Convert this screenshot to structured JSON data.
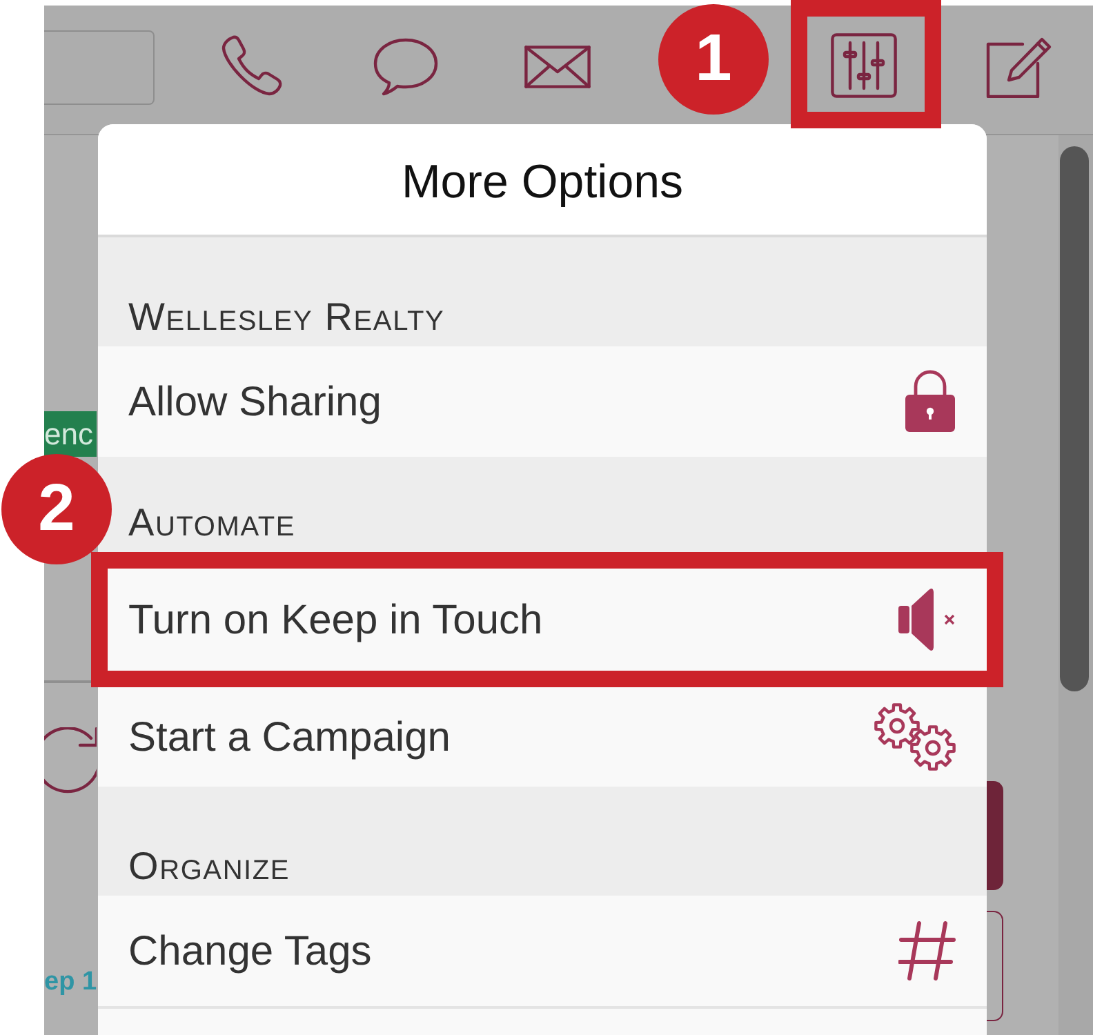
{
  "toolbar": {
    "buttons": [
      {
        "highlighted": false
      },
      {
        "highlighted": false
      },
      {
        "highlighted": false
      },
      {
        "highlighted": true,
        "callout": "1"
      },
      {
        "highlighted": false
      }
    ]
  },
  "page_behind": {
    "tag": "enc",
    "step_label": "ep 1"
  },
  "popover": {
    "title": "More Options",
    "sections": [
      {
        "heading": "Wellesley Realty",
        "items": [
          {
            "label": "Allow Sharing",
            "highlighted": false
          }
        ]
      },
      {
        "heading": "Automate",
        "items": [
          {
            "label": "Turn on Keep in Touch",
            "highlighted": true,
            "callout": "2"
          },
          {
            "label": "Start a Campaign",
            "highlighted": false
          }
        ]
      },
      {
        "heading": "Organize",
        "items": [
          {
            "label": "Change Tags",
            "highlighted": false
          }
        ]
      }
    ]
  }
}
